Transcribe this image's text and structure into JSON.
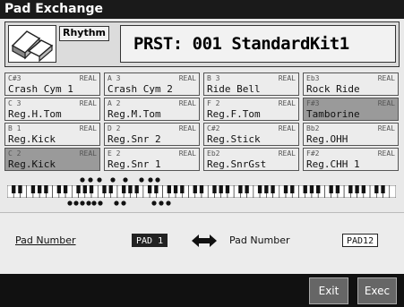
{
  "window": {
    "title": "Pad Exchange"
  },
  "header": {
    "mode_tag": "Rhythm",
    "kit_name": "PRST: 001 StandardKit1"
  },
  "pads": [
    {
      "note": "C#3",
      "real": "REAL",
      "name": "Crash Cym 1",
      "selected": false
    },
    {
      "note": "A 3",
      "real": "REAL",
      "name": "Crash Cym 2",
      "selected": false
    },
    {
      "note": "B 3",
      "real": "REAL",
      "name": "Ride Bell",
      "selected": false
    },
    {
      "note": "Eb3",
      "real": "REAL",
      "name": "Rock Ride",
      "selected": false
    },
    {
      "note": "C 3",
      "real": "REAL",
      "name": "Reg.H.Tom",
      "selected": false
    },
    {
      "note": "A 2",
      "real": "REAL",
      "name": "Reg.M.Tom",
      "selected": false
    },
    {
      "note": "F 2",
      "real": "REAL",
      "name": "Reg.F.Tom",
      "selected": false
    },
    {
      "note": "F#3",
      "real": "REAL",
      "name": "Tamborine",
      "selected": true
    },
    {
      "note": "B 1",
      "real": "REAL",
      "name": "Reg.Kick",
      "selected": false
    },
    {
      "note": "D 2",
      "real": "REAL",
      "name": "Reg.Snr 2",
      "selected": false
    },
    {
      "note": "C#2",
      "real": "REAL",
      "name": "Reg.Stick",
      "selected": false
    },
    {
      "note": "Bb2",
      "real": "REAL",
      "name": "Reg.OHH",
      "selected": false
    },
    {
      "note": "C 2",
      "real": "REAL",
      "name": "Reg.Kick",
      "selected": true
    },
    {
      "note": "E 2",
      "real": "REAL",
      "name": "Reg.Snr 1",
      "selected": false
    },
    {
      "note": "Eb2",
      "real": "REAL",
      "name": "Reg.SnrGst",
      "selected": false
    },
    {
      "note": "F#2",
      "real": "REAL",
      "name": "Reg.CHH 1",
      "selected": false
    }
  ],
  "exchange": {
    "source_label": "Pad Number",
    "source_value": "PAD 1",
    "dest_label": "Pad Number",
    "dest_value": "PAD12"
  },
  "footer": {
    "exit_label": "Exit",
    "exec_label": "Exec"
  }
}
